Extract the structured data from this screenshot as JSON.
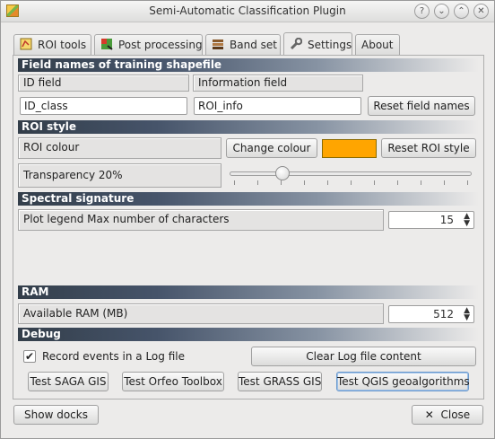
{
  "window": {
    "title": "Semi-Automatic Classification Plugin",
    "help_glyph": "?",
    "minimize_glyph": "⌄",
    "maximize_glyph": "⌃",
    "close_glyph": "✕"
  },
  "tabs": [
    {
      "label": "ROI tools",
      "icon": "roi-tools-icon"
    },
    {
      "label": "Post processing",
      "icon": "post-processing-icon"
    },
    {
      "label": "Band set",
      "icon": "band-set-icon"
    },
    {
      "label": "Settings",
      "icon": "wrench-icon"
    },
    {
      "label": "About"
    }
  ],
  "active_tab": "Settings",
  "field_names": {
    "header": "Field names of training shapefile",
    "id_field_label": "ID field",
    "info_field_label": "Information field",
    "id_value": "ID_class",
    "info_value": "ROI_info",
    "reset_button": "Reset field names"
  },
  "roi_style": {
    "header": "ROI style",
    "colour_label": "ROI colour",
    "change_colour_button": "Change colour",
    "colour": "#ffa500",
    "reset_button": "Reset ROI style",
    "transparency_label": "Transparency 20%",
    "transparency_fraction": 0.2
  },
  "spectral": {
    "header": "Spectral signature",
    "legend_label": "Plot legend Max number of characters",
    "legend_value": "15"
  },
  "ram": {
    "header": "RAM",
    "label": "Available RAM (MB)",
    "value": "512"
  },
  "debug": {
    "header": "Debug",
    "record_label": "Record events in a Log file",
    "record_checked": true,
    "clear_button": "Clear Log file content",
    "test_saga": "Test SAGA GIS",
    "test_otb": "Test Orfeo Toolbox",
    "test_grass": "Test GRASS GIS",
    "test_qgis": "Test QGIS geoalgorithms"
  },
  "footer": {
    "show_docks": "Show docks",
    "close": "Close",
    "close_glyph": "✕"
  }
}
